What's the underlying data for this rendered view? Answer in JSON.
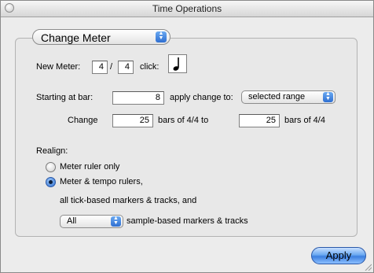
{
  "window": {
    "title": "Time Operations"
  },
  "operation_popup": {
    "selected": "Change Meter"
  },
  "meter": {
    "label": "New Meter:",
    "numerator": "4",
    "separator": "/",
    "denominator": "4",
    "click_label": "click:",
    "note_value_icon": "quarter-note-icon"
  },
  "range": {
    "starting_label": "Starting at bar:",
    "starting_bar": "8",
    "apply_label": "apply change to:",
    "apply_selected": "selected range",
    "change_label": "Change",
    "from_bars": "25",
    "bars_of_from": "bars of 4/4 to",
    "to_bars": "25",
    "bars_of_to": "bars of 4/4"
  },
  "realign": {
    "label": "Realign:",
    "option_meter_only": "Meter ruler only",
    "option_meter_tempo": "Meter & tempo rulers,",
    "meter_tempo_selected": true,
    "tick_based_text": "all tick-based markers & tracks, and",
    "sample_popup_selected": "All",
    "sample_based_text": "sample-based markers & tracks"
  },
  "apply_button": {
    "label": "Apply"
  },
  "colors": {
    "accent": "#3b7fe0",
    "window_bg": "#ececec"
  }
}
